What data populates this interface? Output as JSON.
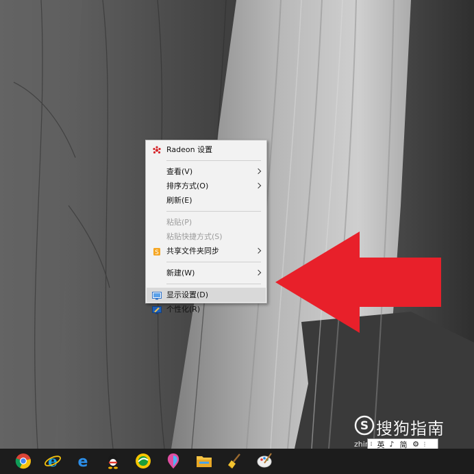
{
  "context_menu": {
    "items": [
      {
        "label": "Radeon 设置",
        "icon": "radeon-icon",
        "submenu": false,
        "disabled": false
      },
      {
        "label": "查看(V)",
        "submenu": true,
        "disabled": false
      },
      {
        "label": "排序方式(O)",
        "submenu": true,
        "disabled": false
      },
      {
        "label": "刷新(E)",
        "submenu": false,
        "disabled": false
      },
      {
        "label": "粘贴(P)",
        "submenu": false,
        "disabled": true
      },
      {
        "label": "粘贴快捷方式(S)",
        "submenu": false,
        "disabled": true
      },
      {
        "label": "共享文件夹同步",
        "icon": "sync-folder-icon",
        "submenu": true,
        "disabled": false
      },
      {
        "label": "新建(W)",
        "submenu": true,
        "disabled": false
      },
      {
        "label": "显示设置(D)",
        "icon": "display-settings-icon",
        "submenu": false,
        "disabled": false,
        "highlighted": true
      },
      {
        "label": "个性化(R)",
        "icon": "personalize-icon",
        "submenu": false,
        "disabled": false
      }
    ]
  },
  "annotation": {
    "arrow_color": "#e8202a",
    "points_to": "显示设置(D)"
  },
  "watermark": {
    "brand": "搜狗指南",
    "url": "zhinan.sogou.com"
  },
  "ime_toolbar": {
    "mode": "英",
    "punctuation": "♪",
    "script": "简",
    "settings_icon": "gear-icon",
    "dropdown": "⋮"
  },
  "taskbar": {
    "apps": [
      "chrome-icon",
      "ie-icon",
      "edge-icon",
      "qq-icon",
      "browser-360-icon",
      "paint3d-icon",
      "file-explorer-icon",
      "cleaner-icon",
      "paint-icon"
    ]
  },
  "colors": {
    "menu_bg": "#f2f2f2",
    "menu_highlight": "#d9d9d9",
    "taskbar_bg": "#1c1c1c",
    "red_arrow": "#e8202a"
  }
}
